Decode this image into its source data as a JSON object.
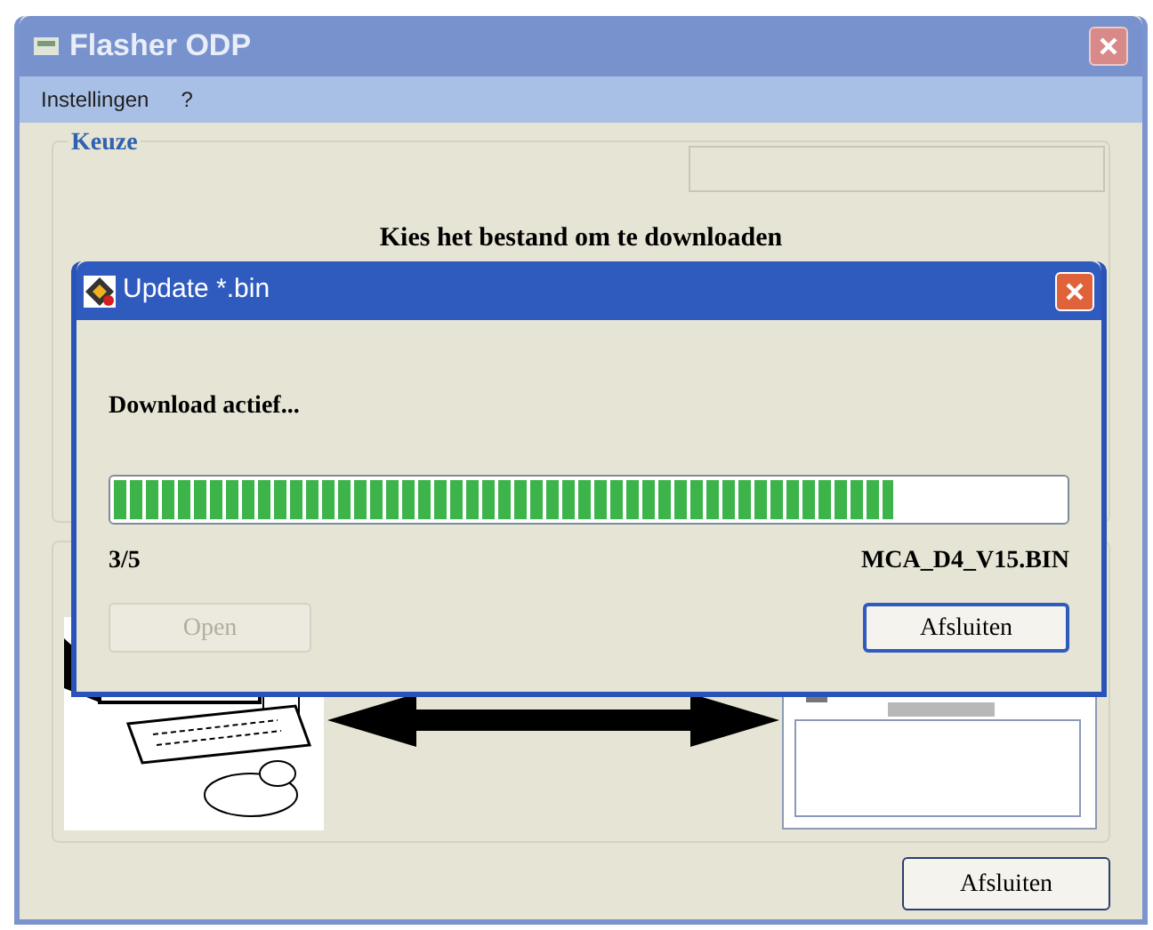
{
  "window": {
    "title": "Flasher ODP"
  },
  "menu": [
    "Instellingen",
    "?"
  ],
  "group": {
    "title": "Keuze",
    "heading": "Kies het bestand om te downloaden"
  },
  "close_button": {
    "label": "Afsluiten"
  },
  "dialog": {
    "title": "Update *.bin",
    "status": "Download actief...",
    "progress": {
      "level": 0.82
    },
    "counter": "3/5",
    "file": "MCA_D4_V15.BIN",
    "buttons": [
      {
        "label": "Open",
        "disabled": true
      },
      {
        "label": "Afsluiten",
        "disabled": false
      }
    ]
  }
}
